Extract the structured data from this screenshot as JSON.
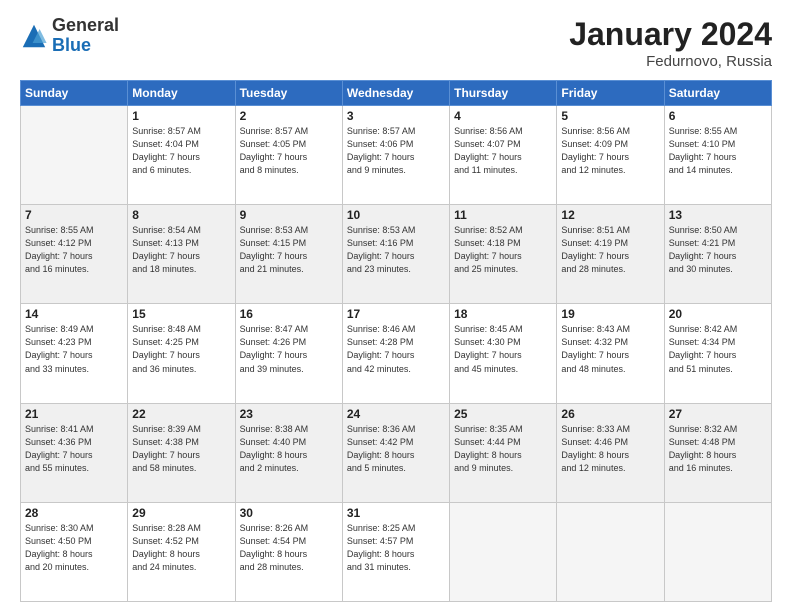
{
  "header": {
    "logo_general": "General",
    "logo_blue": "Blue",
    "month_year": "January 2024",
    "location": "Fedurnovo, Russia"
  },
  "days_of_week": [
    "Sunday",
    "Monday",
    "Tuesday",
    "Wednesday",
    "Thursday",
    "Friday",
    "Saturday"
  ],
  "weeks": [
    [
      {
        "day": "",
        "info": ""
      },
      {
        "day": "1",
        "info": "Sunrise: 8:57 AM\nSunset: 4:04 PM\nDaylight: 7 hours\nand 6 minutes."
      },
      {
        "day": "2",
        "info": "Sunrise: 8:57 AM\nSunset: 4:05 PM\nDaylight: 7 hours\nand 8 minutes."
      },
      {
        "day": "3",
        "info": "Sunrise: 8:57 AM\nSunset: 4:06 PM\nDaylight: 7 hours\nand 9 minutes."
      },
      {
        "day": "4",
        "info": "Sunrise: 8:56 AM\nSunset: 4:07 PM\nDaylight: 7 hours\nand 11 minutes."
      },
      {
        "day": "5",
        "info": "Sunrise: 8:56 AM\nSunset: 4:09 PM\nDaylight: 7 hours\nand 12 minutes."
      },
      {
        "day": "6",
        "info": "Sunrise: 8:55 AM\nSunset: 4:10 PM\nDaylight: 7 hours\nand 14 minutes."
      }
    ],
    [
      {
        "day": "7",
        "info": "Sunrise: 8:55 AM\nSunset: 4:12 PM\nDaylight: 7 hours\nand 16 minutes."
      },
      {
        "day": "8",
        "info": "Sunrise: 8:54 AM\nSunset: 4:13 PM\nDaylight: 7 hours\nand 18 minutes."
      },
      {
        "day": "9",
        "info": "Sunrise: 8:53 AM\nSunset: 4:15 PM\nDaylight: 7 hours\nand 21 minutes."
      },
      {
        "day": "10",
        "info": "Sunrise: 8:53 AM\nSunset: 4:16 PM\nDaylight: 7 hours\nand 23 minutes."
      },
      {
        "day": "11",
        "info": "Sunrise: 8:52 AM\nSunset: 4:18 PM\nDaylight: 7 hours\nand 25 minutes."
      },
      {
        "day": "12",
        "info": "Sunrise: 8:51 AM\nSunset: 4:19 PM\nDaylight: 7 hours\nand 28 minutes."
      },
      {
        "day": "13",
        "info": "Sunrise: 8:50 AM\nSunset: 4:21 PM\nDaylight: 7 hours\nand 30 minutes."
      }
    ],
    [
      {
        "day": "14",
        "info": "Sunrise: 8:49 AM\nSunset: 4:23 PM\nDaylight: 7 hours\nand 33 minutes."
      },
      {
        "day": "15",
        "info": "Sunrise: 8:48 AM\nSunset: 4:25 PM\nDaylight: 7 hours\nand 36 minutes."
      },
      {
        "day": "16",
        "info": "Sunrise: 8:47 AM\nSunset: 4:26 PM\nDaylight: 7 hours\nand 39 minutes."
      },
      {
        "day": "17",
        "info": "Sunrise: 8:46 AM\nSunset: 4:28 PM\nDaylight: 7 hours\nand 42 minutes."
      },
      {
        "day": "18",
        "info": "Sunrise: 8:45 AM\nSunset: 4:30 PM\nDaylight: 7 hours\nand 45 minutes."
      },
      {
        "day": "19",
        "info": "Sunrise: 8:43 AM\nSunset: 4:32 PM\nDaylight: 7 hours\nand 48 minutes."
      },
      {
        "day": "20",
        "info": "Sunrise: 8:42 AM\nSunset: 4:34 PM\nDaylight: 7 hours\nand 51 minutes."
      }
    ],
    [
      {
        "day": "21",
        "info": "Sunrise: 8:41 AM\nSunset: 4:36 PM\nDaylight: 7 hours\nand 55 minutes."
      },
      {
        "day": "22",
        "info": "Sunrise: 8:39 AM\nSunset: 4:38 PM\nDaylight: 7 hours\nand 58 minutes."
      },
      {
        "day": "23",
        "info": "Sunrise: 8:38 AM\nSunset: 4:40 PM\nDaylight: 8 hours\nand 2 minutes."
      },
      {
        "day": "24",
        "info": "Sunrise: 8:36 AM\nSunset: 4:42 PM\nDaylight: 8 hours\nand 5 minutes."
      },
      {
        "day": "25",
        "info": "Sunrise: 8:35 AM\nSunset: 4:44 PM\nDaylight: 8 hours\nand 9 minutes."
      },
      {
        "day": "26",
        "info": "Sunrise: 8:33 AM\nSunset: 4:46 PM\nDaylight: 8 hours\nand 12 minutes."
      },
      {
        "day": "27",
        "info": "Sunrise: 8:32 AM\nSunset: 4:48 PM\nDaylight: 8 hours\nand 16 minutes."
      }
    ],
    [
      {
        "day": "28",
        "info": "Sunrise: 8:30 AM\nSunset: 4:50 PM\nDaylight: 8 hours\nand 20 minutes."
      },
      {
        "day": "29",
        "info": "Sunrise: 8:28 AM\nSunset: 4:52 PM\nDaylight: 8 hours\nand 24 minutes."
      },
      {
        "day": "30",
        "info": "Sunrise: 8:26 AM\nSunset: 4:54 PM\nDaylight: 8 hours\nand 28 minutes."
      },
      {
        "day": "31",
        "info": "Sunrise: 8:25 AM\nSunset: 4:57 PM\nDaylight: 8 hours\nand 31 minutes."
      },
      {
        "day": "",
        "info": ""
      },
      {
        "day": "",
        "info": ""
      },
      {
        "day": "",
        "info": ""
      }
    ]
  ]
}
